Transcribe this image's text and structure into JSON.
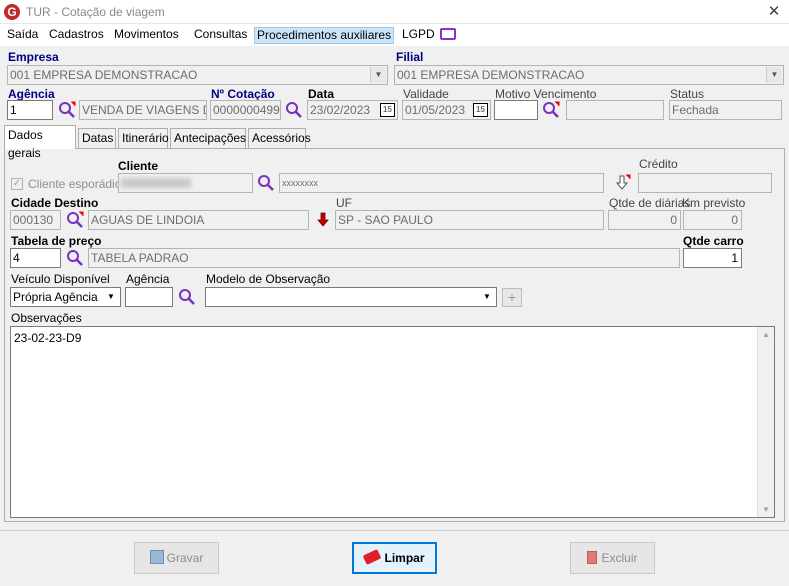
{
  "window": {
    "title": "TUR - Cotação de viagem",
    "logo_letter": "G"
  },
  "menu": [
    "Saída",
    "Cadastros",
    "Movimentos",
    "Consultas",
    "Procedimentos auxiliares",
    "LGPD"
  ],
  "header": {
    "empresa_label": "Empresa",
    "empresa_value": "001 EMPRESA DEMONSTRACAO",
    "filial_label": "Filial",
    "filial_value": "001 EMPRESA DEMONSTRACAO",
    "agencia_label": "Agência",
    "agencia_code": "1",
    "agencia_name": "VENDA DE VIAGENS DE",
    "cotacao_label": "Nº Cotação",
    "cotacao_value": "0000000499",
    "data_label": "Data",
    "data_value": "23/02/2023",
    "validade_label": "Validade",
    "validade_value": "01/05/2023",
    "motivo_label": "Motivo Vencimento",
    "motivo_code": "",
    "motivo_desc": "",
    "status_label": "Status",
    "status_value": "Fechada",
    "calendar_icon_text": "15"
  },
  "tabs": [
    "Dados gerais",
    "Datas",
    "Itinerário",
    "Antecipações",
    "Acessórios"
  ],
  "dados_gerais": {
    "cliente_esporadico_label": "Cliente esporádico",
    "cliente_label": "Cliente",
    "cliente_masked": "xxxxxxxx",
    "credito_label": "Crédito",
    "credito_value": "",
    "cidade_label": "Cidade Destino",
    "cidade_code": "000130",
    "cidade_name": "AGUAS DE LINDOIA",
    "uf_label": "UF",
    "uf_value": "SP - SAO PAULO",
    "qtde_diarias_label": "Qtde de diárias",
    "qtde_diarias_value": "0",
    "km_label": "Km previsto",
    "km_value": "0",
    "tabela_label": "Tabela de preço",
    "tabela_code": "4",
    "tabela_name": "TABELA PADRAO",
    "qtde_carro_label": "Qtde carro",
    "qtde_carro_value": "1",
    "veiculo_label": "Veículo Disponível",
    "veiculo_value": "Própria Agência",
    "agencia2_label": "Agência",
    "agencia2_value": "",
    "modelo_obs_label": "Modelo de Observação",
    "modelo_obs_value": "",
    "obs_label": "Observações",
    "obs_text": "23-02-23-D9"
  },
  "buttons": {
    "gravar": "Gravar",
    "limpar": "Limpar",
    "excluir": "Excluir"
  },
  "colors": {
    "accent_blue": "#000080",
    "search_purple": "#7b2fbe",
    "logo_red": "#c0282d"
  }
}
